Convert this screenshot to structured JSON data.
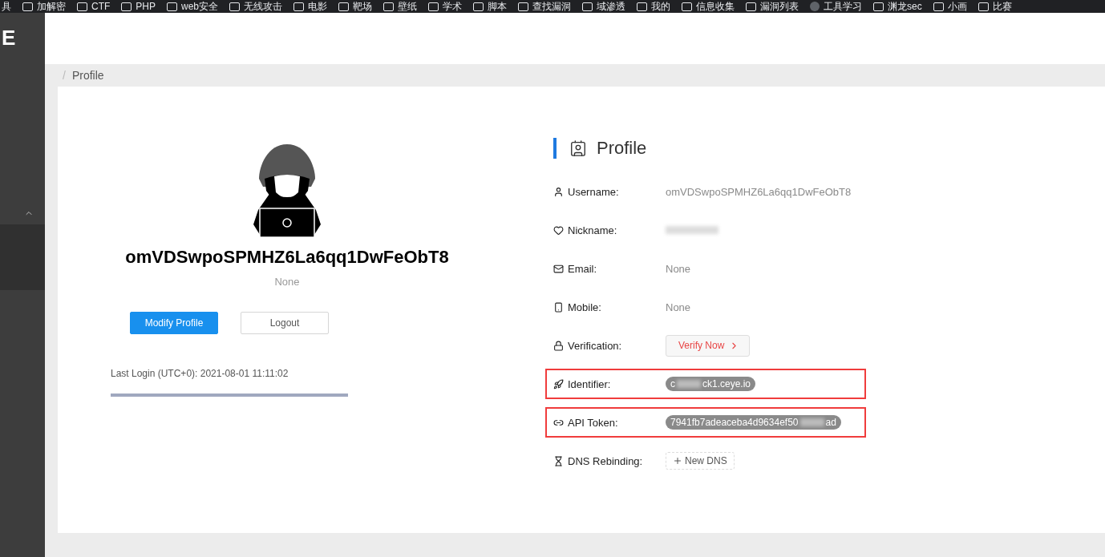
{
  "bookmarks_bar": {
    "items": [
      {
        "label": "具",
        "kind": "text"
      },
      {
        "label": "加解密",
        "kind": "folder"
      },
      {
        "label": "CTF",
        "kind": "folder"
      },
      {
        "label": "PHP",
        "kind": "folder"
      },
      {
        "label": "web安全",
        "kind": "folder"
      },
      {
        "label": "无线攻击",
        "kind": "folder"
      },
      {
        "label": "电影",
        "kind": "folder"
      },
      {
        "label": "靶场",
        "kind": "folder"
      },
      {
        "label": "壁纸",
        "kind": "folder"
      },
      {
        "label": "学术",
        "kind": "folder"
      },
      {
        "label": "脚本",
        "kind": "folder"
      },
      {
        "label": "查找漏洞",
        "kind": "folder"
      },
      {
        "label": "域渗透",
        "kind": "folder"
      },
      {
        "label": "我的",
        "kind": "folder"
      },
      {
        "label": "信息收集",
        "kind": "folder"
      },
      {
        "label": "漏洞列表",
        "kind": "folder"
      },
      {
        "label": "工具学习",
        "kind": "site"
      },
      {
        "label": "渊龙sec",
        "kind": "folder"
      },
      {
        "label": "小画",
        "kind": "folder"
      },
      {
        "label": "比赛",
        "kind": "folder"
      }
    ]
  },
  "sidebar": {
    "logo_text": "E"
  },
  "breadcrumb": {
    "separator": "/",
    "items": [
      "Profile"
    ]
  },
  "profile_card": {
    "username": "omVDSwpoSPMHZ6La6qq1DwFeObT8",
    "nickname": "None",
    "buttons": [
      {
        "label": "Modify Profile",
        "kind": "primary"
      },
      {
        "label": "Logout",
        "kind": "default"
      }
    ],
    "last_login": "Last Login (UTC+0): 2021-08-01 11:11:02"
  },
  "details": {
    "title": "Profile",
    "rows": [
      {
        "label": "Username:",
        "kind": "text",
        "value": "omVDSwpoSPMHZ6La6qq1DwFeObT8",
        "highlighted": false
      },
      {
        "label": "Nickname:",
        "kind": "redacted",
        "highlighted": false
      },
      {
        "label": "Email:",
        "kind": "text",
        "value": "None",
        "highlighted": false
      },
      {
        "label": "Mobile:",
        "kind": "text",
        "value": "None",
        "highlighted": false
      },
      {
        "label": "Verification:",
        "kind": "action",
        "value": "Verify Now",
        "highlighted": false
      },
      {
        "label": "Identifier:",
        "kind": "tag",
        "value": "c",
        "value_end": "ck1.ceye.io",
        "highlighted": true
      },
      {
        "label": "API Token:",
        "kind": "tag",
        "value": "7941fb7adeaceba4d9634ef50",
        "value_end": "ad",
        "highlighted": true
      },
      {
        "label": "DNS Rebinding:",
        "kind": "add",
        "value": "New DNS",
        "highlighted": false
      }
    ]
  }
}
